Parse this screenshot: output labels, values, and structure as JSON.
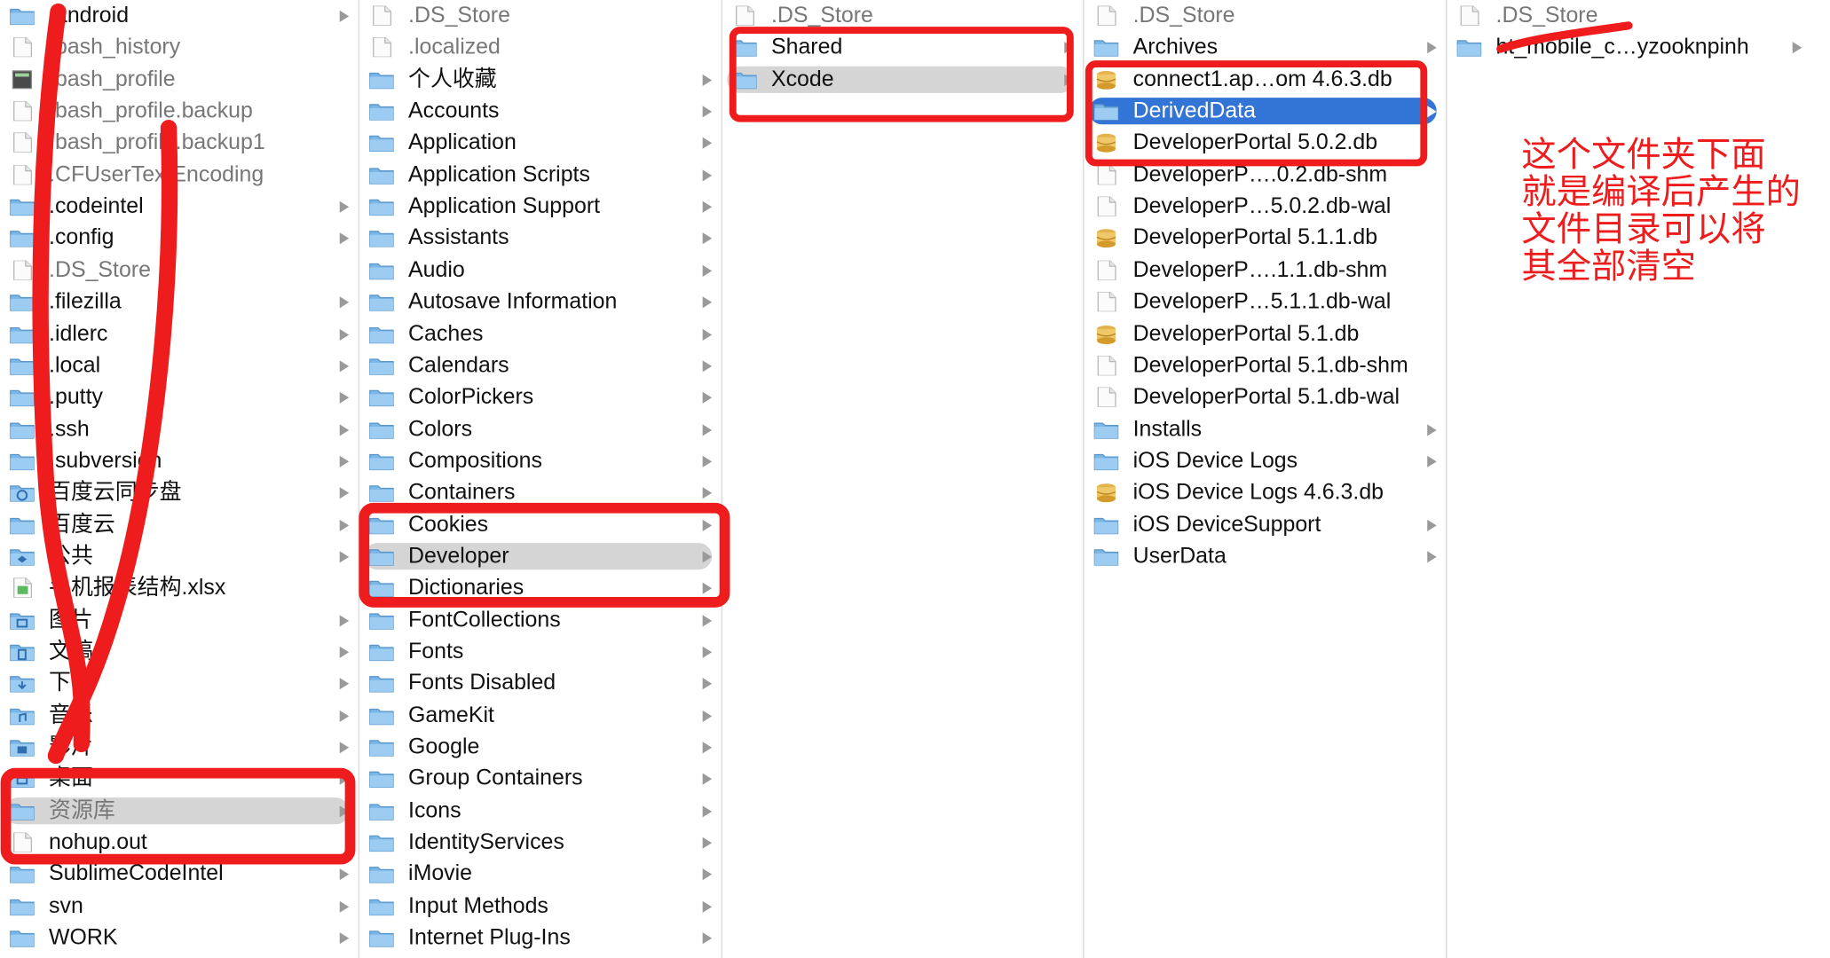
{
  "colors": {
    "annotation": "#ee1c1c",
    "folder": "#7ab6e6",
    "selection_active": "#3375d6",
    "selection_inactive": "#d5d5d5"
  },
  "columns": [
    {
      "items": [
        {
          "label": ".android",
          "icon": "folder-icon",
          "arrow": true
        },
        {
          "label": ".bash_history",
          "icon": "document-icon",
          "dim": true
        },
        {
          "label": ".bash_profile",
          "icon": "executable-icon",
          "dim": true
        },
        {
          "label": ".bash_profile.backup",
          "icon": "document-icon",
          "dim": true
        },
        {
          "label": ".bash_profile.backup1",
          "icon": "document-icon",
          "dim": true
        },
        {
          "label": ".CFUserTextEncoding",
          "icon": "document-icon",
          "dim": true
        },
        {
          "label": ".codeintel",
          "icon": "folder-icon",
          "arrow": true
        },
        {
          "label": ".config",
          "icon": "folder-icon",
          "arrow": true
        },
        {
          "label": ".DS_Store",
          "icon": "document-icon",
          "dim": true
        },
        {
          "label": ".filezilla",
          "icon": "folder-icon",
          "arrow": true
        },
        {
          "label": ".idlerc",
          "icon": "folder-icon",
          "arrow": true
        },
        {
          "label": ".local",
          "icon": "folder-icon",
          "arrow": true
        },
        {
          "label": ".putty",
          "icon": "folder-icon",
          "arrow": true
        },
        {
          "label": ".ssh",
          "icon": "folder-icon",
          "arrow": true
        },
        {
          "label": ".subversion",
          "icon": "folder-icon",
          "arrow": true
        },
        {
          "label": "百度云同步盘",
          "icon": "sync-folder-icon",
          "arrow": true
        },
        {
          "label": "百度云",
          "icon": "folder-icon",
          "arrow": true
        },
        {
          "label": "公共",
          "icon": "public-folder-icon",
          "arrow": true
        },
        {
          "label": "手机报表结构.xlsx",
          "icon": "spreadsheet-icon"
        },
        {
          "label": "图片",
          "icon": "pictures-folder-icon",
          "arrow": true
        },
        {
          "label": "文稿",
          "icon": "documents-folder-icon",
          "arrow": true
        },
        {
          "label": "下载",
          "icon": "downloads-folder-icon",
          "arrow": true
        },
        {
          "label": "音乐",
          "icon": "music-folder-icon",
          "arrow": true
        },
        {
          "label": "影片",
          "icon": "movies-folder-icon",
          "arrow": true
        },
        {
          "label": "桌面",
          "icon": "desktop-folder-icon",
          "arrow": true
        },
        {
          "label": "资源库",
          "icon": "folder-icon",
          "arrow": true,
          "selected": "gray",
          "dim": true
        },
        {
          "label": "nohup.out",
          "icon": "document-icon"
        },
        {
          "label": "SublimeCodeIntel",
          "icon": "folder-icon",
          "arrow": true
        },
        {
          "label": "svn",
          "icon": "folder-icon",
          "arrow": true
        },
        {
          "label": "WORK",
          "icon": "folder-icon",
          "arrow": true
        }
      ]
    },
    {
      "items": [
        {
          "label": ".DS_Store",
          "icon": "document-icon",
          "dim": true
        },
        {
          "label": ".localized",
          "icon": "document-icon",
          "dim": true
        },
        {
          "label": "个人收藏",
          "icon": "folder-icon",
          "arrow": true
        },
        {
          "label": "Accounts",
          "icon": "folder-icon",
          "arrow": true
        },
        {
          "label": "Application",
          "icon": "folder-icon",
          "arrow": true
        },
        {
          "label": "Application Scripts",
          "icon": "folder-icon",
          "arrow": true
        },
        {
          "label": "Application Support",
          "icon": "folder-icon",
          "arrow": true
        },
        {
          "label": "Assistants",
          "icon": "folder-icon",
          "arrow": true
        },
        {
          "label": "Audio",
          "icon": "folder-icon",
          "arrow": true
        },
        {
          "label": "Autosave Information",
          "icon": "folder-icon",
          "arrow": true
        },
        {
          "label": "Caches",
          "icon": "folder-icon",
          "arrow": true
        },
        {
          "label": "Calendars",
          "icon": "folder-icon",
          "arrow": true
        },
        {
          "label": "ColorPickers",
          "icon": "folder-icon",
          "arrow": true
        },
        {
          "label": "Colors",
          "icon": "folder-icon",
          "arrow": true
        },
        {
          "label": "Compositions",
          "icon": "folder-icon",
          "arrow": true
        },
        {
          "label": "Containers",
          "icon": "folder-icon",
          "arrow": true
        },
        {
          "label": "Cookies",
          "icon": "folder-icon",
          "arrow": true
        },
        {
          "label": "Developer",
          "icon": "folder-icon",
          "arrow": true,
          "selected": "gray"
        },
        {
          "label": "Dictionaries",
          "icon": "folder-icon",
          "arrow": true
        },
        {
          "label": "FontCollections",
          "icon": "folder-icon",
          "arrow": true
        },
        {
          "label": "Fonts",
          "icon": "folder-icon",
          "arrow": true
        },
        {
          "label": "Fonts Disabled",
          "icon": "folder-icon",
          "arrow": true
        },
        {
          "label": "GameKit",
          "icon": "folder-icon",
          "arrow": true
        },
        {
          "label": "Google",
          "icon": "folder-icon",
          "arrow": true
        },
        {
          "label": "Group Containers",
          "icon": "folder-icon",
          "arrow": true
        },
        {
          "label": "Icons",
          "icon": "folder-icon",
          "arrow": true
        },
        {
          "label": "IdentityServices",
          "icon": "folder-icon",
          "arrow": true
        },
        {
          "label": "iMovie",
          "icon": "folder-icon",
          "arrow": true
        },
        {
          "label": "Input Methods",
          "icon": "folder-icon",
          "arrow": true
        },
        {
          "label": "Internet Plug-Ins",
          "icon": "folder-icon",
          "arrow": true
        }
      ]
    },
    {
      "items": [
        {
          "label": ".DS_Store",
          "icon": "document-icon",
          "dim": true
        },
        {
          "label": "Shared",
          "icon": "folder-icon",
          "arrow": true
        },
        {
          "label": "Xcode",
          "icon": "folder-icon",
          "arrow": true,
          "selected": "gray"
        }
      ]
    },
    {
      "items": [
        {
          "label": ".DS_Store",
          "icon": "document-icon",
          "dim": true
        },
        {
          "label": "Archives",
          "icon": "folder-icon",
          "arrow": true
        },
        {
          "label": "connect1.ap…om 4.6.3.db",
          "icon": "database-icon"
        },
        {
          "label": "DerivedData",
          "icon": "folder-icon",
          "arrow": true,
          "selected": "blue"
        },
        {
          "label": "DeveloperPortal 5.0.2.db",
          "icon": "database-icon"
        },
        {
          "label": "DeveloperP….0.2.db-shm",
          "icon": "document-icon"
        },
        {
          "label": "DeveloperP…5.0.2.db-wal",
          "icon": "document-icon"
        },
        {
          "label": "DeveloperPortal 5.1.1.db",
          "icon": "database-icon"
        },
        {
          "label": "DeveloperP….1.1.db-shm",
          "icon": "document-icon"
        },
        {
          "label": "DeveloperP…5.1.1.db-wal",
          "icon": "document-icon"
        },
        {
          "label": "DeveloperPortal 5.1.db",
          "icon": "database-icon"
        },
        {
          "label": "DeveloperPortal 5.1.db-shm",
          "icon": "document-icon"
        },
        {
          "label": "DeveloperPortal 5.1.db-wal",
          "icon": "document-icon"
        },
        {
          "label": "Installs",
          "icon": "folder-icon",
          "arrow": true
        },
        {
          "label": "iOS Device Logs",
          "icon": "folder-icon",
          "arrow": true
        },
        {
          "label": "iOS Device Logs 4.6.3.db",
          "icon": "database-icon"
        },
        {
          "label": "iOS DeviceSupport",
          "icon": "folder-icon",
          "arrow": true
        },
        {
          "label": "UserData",
          "icon": "folder-icon",
          "arrow": true
        }
      ]
    },
    {
      "items": [
        {
          "label": ".DS_Store",
          "icon": "document-icon",
          "dim": true
        },
        {
          "label": "ht_mobile_c…yzooknpinh",
          "icon": "folder-icon",
          "arrow": true
        }
      ]
    }
  ],
  "annotation": {
    "lines": [
      "这个文件夹下面",
      "就是编译后产生的",
      "文件目录可以将",
      "其全部清空"
    ]
  }
}
